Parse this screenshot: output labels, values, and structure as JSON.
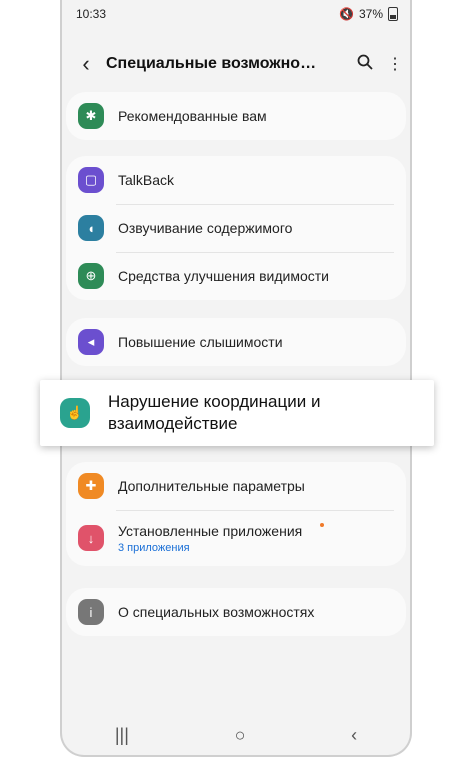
{
  "status": {
    "time": "10:33",
    "battery": "37%",
    "mute_icon": "mute-icon"
  },
  "header": {
    "title": "Специальные возможно…",
    "back_icon": "back-arrow-icon",
    "search_icon": "search-icon",
    "more_icon": "more-vert-icon"
  },
  "recommended": {
    "label": "Рекомендованные вам",
    "icon_color": "#2e8b57"
  },
  "group1": [
    {
      "label": "TalkBack",
      "icon_color": "#6b4fcf"
    },
    {
      "label": "Озвучивание содержимого",
      "icon_color": "#2c7fa0"
    },
    {
      "label": "Средства улучшения видимости",
      "icon_color": "#2e8b57"
    }
  ],
  "hearing": {
    "label": "Повышение слышимости",
    "icon_color": "#6b4fcf"
  },
  "highlight": {
    "label_line1": "Нарушение координации и",
    "label_line2": "взаимодействие",
    "icon_color": "#2aa38f"
  },
  "group3": [
    {
      "label": "Дополнительные параметры",
      "icon_color": "#f08a24"
    },
    {
      "label": "Установленные приложения",
      "sub": "3 приложения",
      "icon_color": "#e0536a"
    }
  ],
  "about": {
    "label": "О специальных возможностях",
    "icon_color": "#777777"
  },
  "nav": {
    "recents": "|||",
    "home": "○",
    "back": "‹"
  }
}
